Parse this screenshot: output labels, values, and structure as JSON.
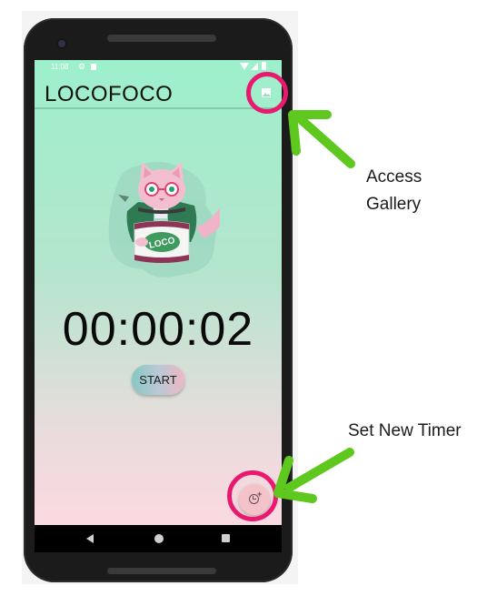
{
  "status_bar": {
    "time": "11:08"
  },
  "app_bar": {
    "title": "LOCOFOCO"
  },
  "mascot": {
    "jar_text": "LOCO"
  },
  "timer": {
    "display": "00:00:02"
  },
  "controls": {
    "start_label": "START"
  },
  "annotations": {
    "gallery_line1": "Access",
    "gallery_line2": "Gallery",
    "new_timer": "Set New Timer"
  },
  "colors": {
    "highlight": "#e8196e",
    "arrow": "#5ec81e",
    "screen_top": "#9df0cc",
    "screen_bottom": "#fbd9e0"
  },
  "icons": {
    "gallery": "image-icon",
    "fab": "alarm-add-icon",
    "status_settings": "gear-icon",
    "status_sd": "sd-card-icon",
    "status_wifi": "wifi-icon",
    "status_signal": "signal-icon",
    "status_battery": "battery-icon",
    "nav_back": "back-icon",
    "nav_home": "home-icon",
    "nav_recent": "recent-apps-icon"
  }
}
